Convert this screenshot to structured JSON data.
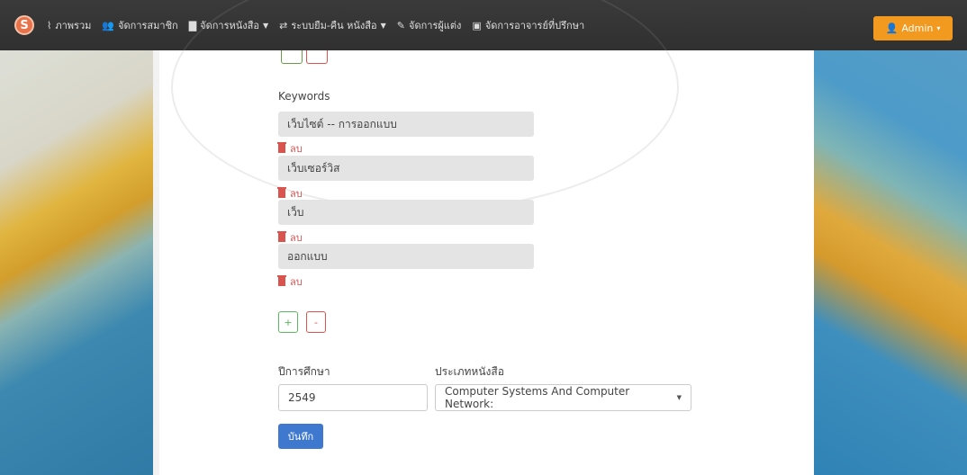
{
  "navbar": {
    "logo": "S",
    "items": [
      {
        "icon": "chart-icon",
        "glyph": "⌇",
        "label": "ภาพรวม",
        "dropdown": false
      },
      {
        "icon": "users-icon",
        "glyph": "👥",
        "label": "จัดการสมาชิก",
        "dropdown": false
      },
      {
        "icon": "book-icon",
        "glyph": "▇",
        "label": "จัดการหนังสือ",
        "dropdown": true
      },
      {
        "icon": "exchange-icon",
        "glyph": "⇄",
        "label": "ระบบยืม-คืน หนังสือ",
        "dropdown": true
      },
      {
        "icon": "author-icon",
        "glyph": "✎",
        "label": "จัดการผู้แต่ง",
        "dropdown": false
      },
      {
        "icon": "advisor-icon",
        "glyph": "▣",
        "label": "จัดการอาจารย์ที่ปรึกษา",
        "dropdown": false
      }
    ],
    "admin": {
      "label": "Admin",
      "icon": "user-icon",
      "glyph": "👤",
      "caret": "▾",
      "color": "#f29a20"
    }
  },
  "form": {
    "keywords_label": "Keywords",
    "keywords": [
      {
        "value": "เว็บไซต์ -- การออกแบบ",
        "delete": "ลบ"
      },
      {
        "value": "เว็บเซอร์วิส",
        "delete": "ลบ"
      },
      {
        "value": "เว็บ",
        "delete": "ลบ"
      },
      {
        "value": "ออกแบบ",
        "delete": "ลบ"
      }
    ],
    "add_button": "+",
    "remove_button": "-",
    "year_label": "ปีการศึกษา",
    "year_value": "2549",
    "type_label": "ประเภทหนังสือ",
    "type_value": "Computer Systems And Computer Network:",
    "select_arrow": "▼",
    "save_button": "บันทึก"
  },
  "colors": {
    "accent_save": "#3f78cf",
    "delete": "#d9534f",
    "add": "#5cb85c",
    "navbar": "#333333"
  }
}
